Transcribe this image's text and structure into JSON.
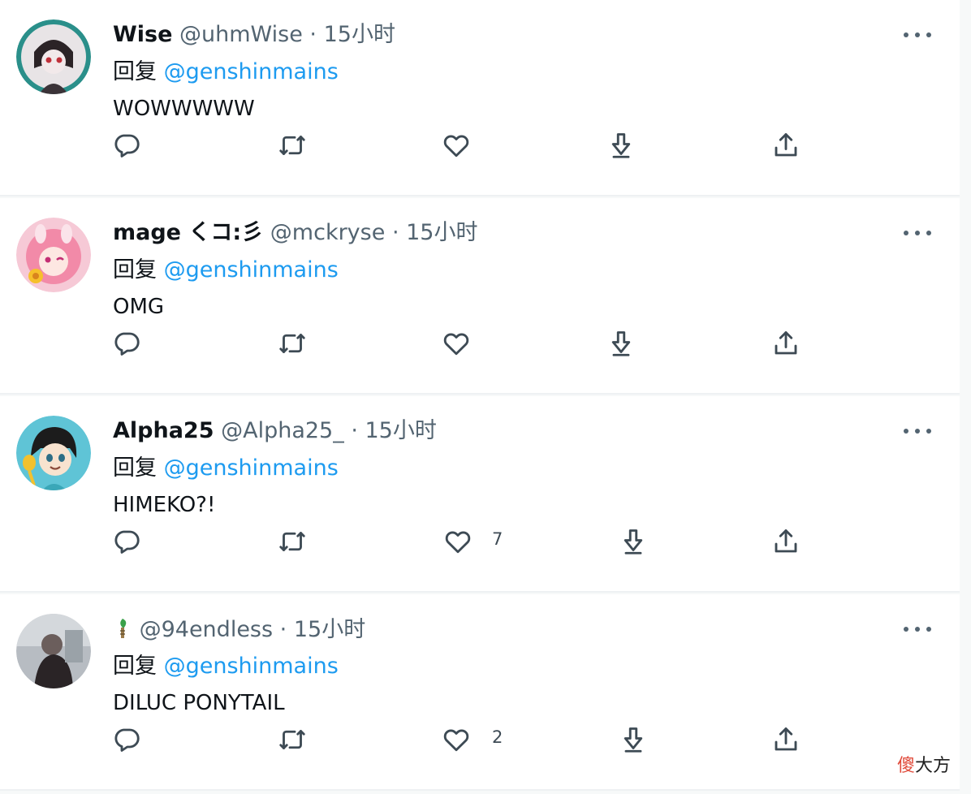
{
  "tweets": [
    {
      "name": "Wise",
      "handle": "@uhmWise",
      "dot": "·",
      "time": "15小时",
      "reply_label": "回复",
      "reply_to": "@genshinmains",
      "text": "WOWWWWW",
      "likes": ""
    },
    {
      "name": "mage くコ:彡",
      "handle": "@mckryse",
      "dot": "·",
      "time": "15小时",
      "reply_label": "回复",
      "reply_to": "@genshinmains",
      "text": "OMG",
      "likes": ""
    },
    {
      "name": "Alpha25",
      "handle": "@Alpha25_",
      "dot": "·",
      "time": "15小时",
      "reply_label": "回复",
      "reply_to": "@genshinmains",
      "text": "HIMEKO?!",
      "likes": "7"
    },
    {
      "name": "",
      "name_icon": "sprout-emoji-icon",
      "handle": "@94endless",
      "dot": "·",
      "time": "15小时",
      "reply_label": "回复",
      "reply_to": "@genshinmains",
      "text": "DILUC PONYTAIL",
      "likes": "2"
    }
  ],
  "icons": [
    "reply-icon",
    "retweet-icon",
    "like-icon",
    "download-icon",
    "share-icon",
    "more-icon"
  ],
  "colors": {
    "mention": "#1d9bf0",
    "secondary_text": "#536471",
    "background": "#f7f9f9"
  },
  "watermark": {
    "part1": "傻",
    "part2": "大方"
  }
}
